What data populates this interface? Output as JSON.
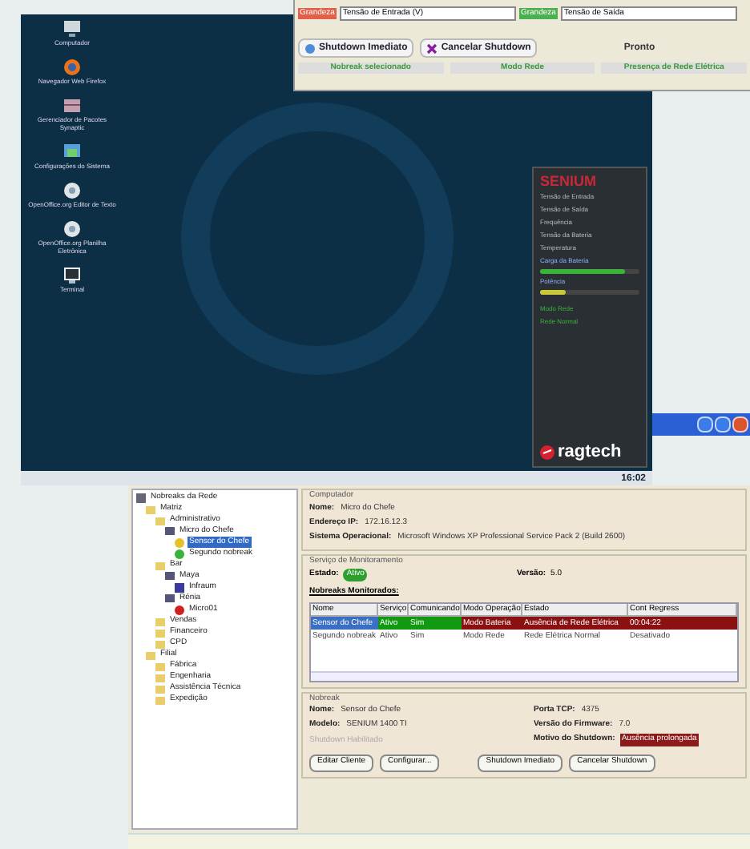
{
  "top_window": {
    "fields": [
      {
        "kind": "input",
        "label": "Grandeza",
        "value": "Tensão de Entrada (V)",
        "color": "#e0604a"
      },
      {
        "kind": "input",
        "label": "Grandeza",
        "value": "Tensão de Saída",
        "color": "#4caf50"
      }
    ],
    "buttons": [
      {
        "label": "Shutdown Imediato"
      },
      {
        "label": "Cancelar Shutdown"
      }
    ],
    "status": "Pronto",
    "status_bar": [
      {
        "text": "Nobreak selecionado",
        "color": "#3a9a3a"
      },
      {
        "text": "Modo Rede",
        "color": "#3a9a3a"
      },
      {
        "text": "Presença de Rede Elétrica",
        "color": "#3a9a3a"
      }
    ]
  },
  "desktop": {
    "icons": [
      {
        "label": "Computador",
        "kind": "computer"
      },
      {
        "label": "Navegador Web Firefox",
        "kind": "browser"
      },
      {
        "label": "Gerenciador de Pacotes Synaptic",
        "kind": "package"
      },
      {
        "label": "Configurações do Sistema",
        "kind": "settings"
      },
      {
        "label": "OpenOffice.org Editor de Texto",
        "kind": "document"
      },
      {
        "label": "OpenOffice.org Planilha Eletrônica",
        "kind": "document"
      },
      {
        "label": "Terminal",
        "kind": "terminal"
      }
    ],
    "widget": {
      "title": "SENIUM",
      "rows": [
        {
          "kind": "text",
          "label": "Tensão de Entrada"
        },
        {
          "kind": "text",
          "label": "Tensão de Saída"
        },
        {
          "kind": "text",
          "label": "Frequência"
        },
        {
          "kind": "text",
          "label": "Tensão da Bateria"
        },
        {
          "kind": "text",
          "label": "Temperatura"
        },
        {
          "kind": "bar",
          "label": "Carga da Bateria",
          "level": 0.85
        },
        {
          "kind": "bar",
          "label": "Potência",
          "level": 0.25
        }
      ],
      "mode": "Modo Rede",
      "status": "Rede Normal",
      "brand": "ragtech"
    },
    "clock": "16:02"
  },
  "app": {
    "tree": [
      {
        "label": "Nobreaks da Rede",
        "kind": "root",
        "children": [
          {
            "label": "Matriz",
            "kind": "folder",
            "children": [
              {
                "label": "Administrativo",
                "kind": "folder",
                "children": [
                  {
                    "label": "Micro do Chefe",
                    "kind": "computer",
                    "children": [
                      {
                        "label": "Sensor do Chefe",
                        "kind": "warning",
                        "selected": true
                      },
                      {
                        "label": "Segundo nobreak",
                        "kind": "ok",
                        "selected": false
                      }
                    ]
                  }
                ]
              },
              {
                "label": "Bar",
                "kind": "folder",
                "children": [
                  {
                    "label": "Maya",
                    "kind": "computer",
                    "children": [
                      {
                        "label": "Infraum",
                        "kind": "device",
                        "selected": false
                      }
                    ]
                  },
                  {
                    "label": "Rénia",
                    "kind": "computer",
                    "children": [
                      {
                        "label": "Micro01",
                        "kind": "error",
                        "selected": false
                      }
                    ]
                  }
                ]
              },
              {
                "label": "Vendas",
                "kind": "folder"
              },
              {
                "label": "Financeiro",
                "kind": "folder"
              },
              {
                "label": "CPD",
                "kind": "folder"
              }
            ]
          },
          {
            "label": "Filial",
            "kind": "folder",
            "children": [
              {
                "label": "Fábrica",
                "kind": "folder"
              },
              {
                "label": "Engenharia",
                "kind": "folder"
              },
              {
                "label": "Assistência Técnica",
                "kind": "folder"
              },
              {
                "label": "Expedição",
                "kind": "folder"
              }
            ]
          }
        ]
      }
    ],
    "computer": {
      "title": "Computador",
      "fields": [
        {
          "label": "Nome:",
          "value": "Micro do Chefe"
        },
        {
          "label": "Endereço IP:",
          "value": "172.16.12.3"
        },
        {
          "label": "Sistema Operacional:",
          "value": "Microsoft Windows XP Professional Service Pack 2 (Build 2600)"
        }
      ]
    },
    "service": {
      "title": "Serviço de Monitoramento",
      "state_label": "Estado:",
      "state": "Ativo",
      "version_label": "Versão:",
      "version": "5.0",
      "table_title": "Nobreaks Monitorados:",
      "columns": [
        "Nome",
        "Serviço",
        "Comunicando",
        "Modo Operação",
        "Estado",
        "Cont Regress"
      ],
      "rows": [
        {
          "selected": true,
          "cells": [
            "Sensor do Chefe",
            "Ativo",
            "Sim",
            "Modo Bateria",
            "Ausência de Rede Elétrica",
            "00:04:22"
          ]
        },
        {
          "selected": false,
          "cells": [
            "Segundo nobreak",
            "Ativo",
            "Sim",
            "Modo Rede",
            "Rede Elétrica Normal",
            "Desativado"
          ]
        }
      ]
    },
    "nobreak": {
      "title": "Nobreak",
      "left": [
        {
          "label": "Nome:",
          "value": "Sensor do Chefe"
        },
        {
          "label": "Modelo:",
          "value": "SENIUM 1400 TI"
        }
      ],
      "disabled_label": "Shutdown Habilitado",
      "right": [
        {
          "label": "Porta TCP:",
          "value": "4375",
          "alert": false
        },
        {
          "label": "Versão do Firmware:",
          "value": "7.0",
          "alert": false
        },
        {
          "label": "Motivo do Shutdown:",
          "value": "Ausência prolongada",
          "alert": true
        }
      ],
      "buttons": [
        "Editar Cliente",
        "Configurar...",
        "Shutdown Imediato",
        "Cancelar Shutdown"
      ]
    }
  }
}
